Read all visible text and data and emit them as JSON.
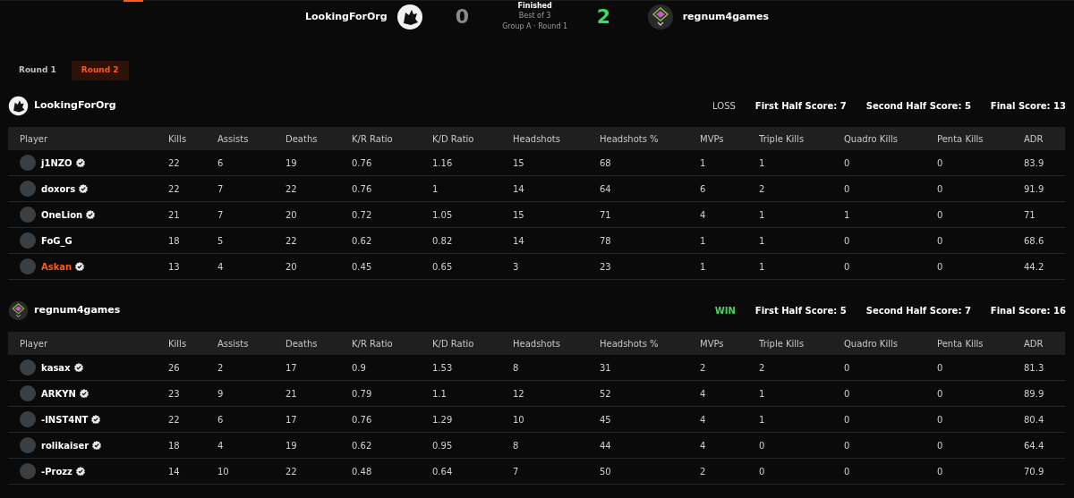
{
  "header": {
    "status": "Finished",
    "format": "Best of 3",
    "stage": "Group A · Round 1",
    "teams": [
      {
        "name": "LookingForOrg",
        "score": "0",
        "won": false
      },
      {
        "name": "regnum4games",
        "score": "2",
        "won": true
      }
    ]
  },
  "round_tabs": [
    {
      "label": "Round 1",
      "selected": false
    },
    {
      "label": "Round 2",
      "selected": true
    }
  ],
  "teams": [
    {
      "name": "LookingForOrg",
      "result": "LOSS",
      "won": false,
      "scores": [
        "First Half Score: 7",
        "Second Half Score: 5",
        "Final Score: 13"
      ],
      "columns": [
        "Player",
        "Kills",
        "Assists",
        "Deaths",
        "K/R Ratio",
        "K/D Ratio",
        "Headshots",
        "Headshots %",
        "MVPs",
        "Triple Kills",
        "Quadro Kills",
        "Penta Kills",
        "ADR"
      ],
      "players": [
        {
          "name": "j1NZO",
          "verified": true,
          "highlighted": false,
          "stats": [
            "22",
            "6",
            "19",
            "0.76",
            "1.16",
            "15",
            "68",
            "1",
            "1",
            "0",
            "0",
            "83.9"
          ]
        },
        {
          "name": "doxors",
          "verified": true,
          "highlighted": false,
          "stats": [
            "22",
            "7",
            "22",
            "0.76",
            "1",
            "14",
            "64",
            "6",
            "2",
            "0",
            "0",
            "91.9"
          ]
        },
        {
          "name": "OneLion",
          "verified": true,
          "highlighted": false,
          "stats": [
            "21",
            "7",
            "20",
            "0.72",
            "1.05",
            "15",
            "71",
            "4",
            "1",
            "1",
            "0",
            "71"
          ]
        },
        {
          "name": "FoG_G",
          "verified": false,
          "highlighted": false,
          "stats": [
            "18",
            "5",
            "22",
            "0.62",
            "0.82",
            "14",
            "78",
            "1",
            "1",
            "0",
            "0",
            "68.6"
          ]
        },
        {
          "name": "Askan",
          "verified": true,
          "highlighted": true,
          "stats": [
            "13",
            "4",
            "20",
            "0.45",
            "0.65",
            "3",
            "23",
            "1",
            "1",
            "0",
            "0",
            "44.2"
          ]
        }
      ]
    },
    {
      "name": "regnum4games",
      "result": "WIN",
      "won": true,
      "scores": [
        "First Half Score: 5",
        "Second Half Score: 7",
        "Final Score: 16"
      ],
      "columns": [
        "Player",
        "Kills",
        "Assists",
        "Deaths",
        "K/R Ratio",
        "K/D Ratio",
        "Headshots",
        "Headshots %",
        "MVPs",
        "Triple Kills",
        "Quadro Kills",
        "Penta Kills",
        "ADR"
      ],
      "players": [
        {
          "name": "kasax",
          "verified": true,
          "highlighted": false,
          "stats": [
            "26",
            "2",
            "17",
            "0.9",
            "1.53",
            "8",
            "31",
            "2",
            "2",
            "0",
            "0",
            "81.3"
          ]
        },
        {
          "name": "ARKYN",
          "verified": true,
          "highlighted": false,
          "stats": [
            "23",
            "9",
            "21",
            "0.79",
            "1.1",
            "12",
            "52",
            "4",
            "1",
            "0",
            "0",
            "89.9"
          ]
        },
        {
          "name": "-INST4NT",
          "verified": true,
          "highlighted": false,
          "stats": [
            "22",
            "6",
            "17",
            "0.76",
            "1.29",
            "10",
            "45",
            "4",
            "1",
            "0",
            "0",
            "80.4"
          ]
        },
        {
          "name": "rolikaiser",
          "verified": true,
          "highlighted": false,
          "stats": [
            "18",
            "4",
            "19",
            "0.62",
            "0.95",
            "8",
            "44",
            "4",
            "0",
            "0",
            "0",
            "64.4"
          ]
        },
        {
          "name": "-Prozz",
          "verified": true,
          "highlighted": false,
          "stats": [
            "14",
            "10",
            "22",
            "0.48",
            "0.64",
            "7",
            "50",
            "2",
            "0",
            "0",
            "0",
            "70.9"
          ]
        }
      ]
    }
  ]
}
